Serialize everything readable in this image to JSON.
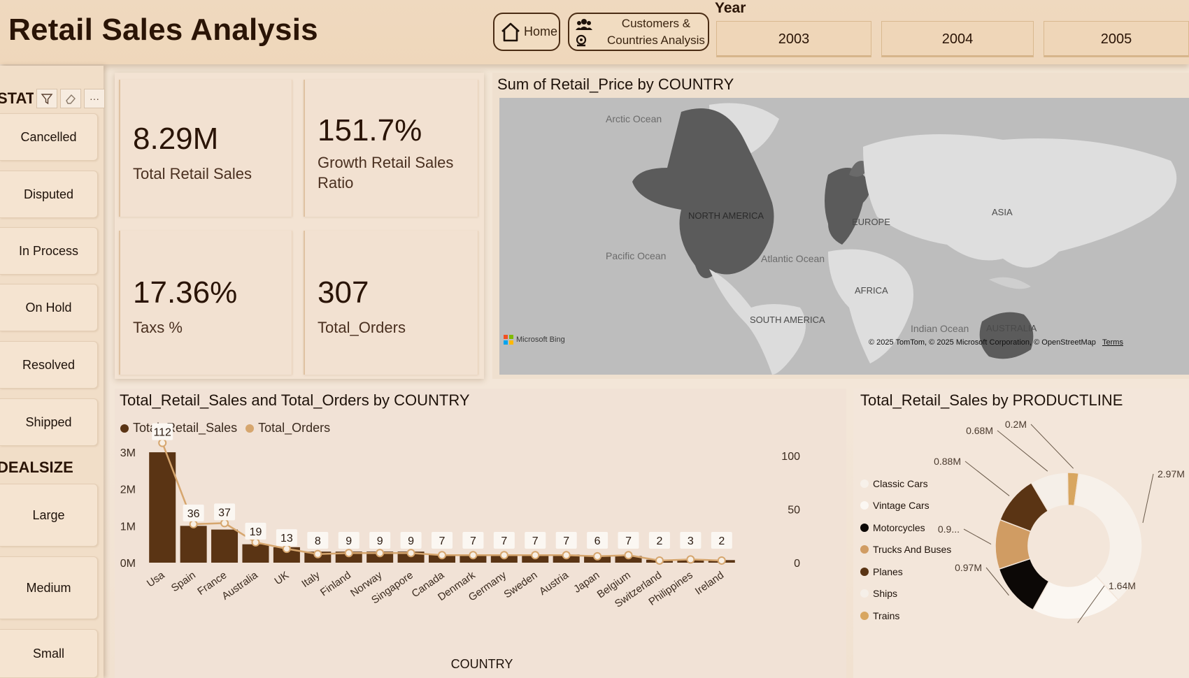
{
  "header": {
    "title": "Retail Sales Analysis",
    "nav": {
      "home_label": "Home",
      "customers_label_1": "Customers &",
      "customers_label_2": "Countries Analysis"
    },
    "year_label": "Year",
    "years": [
      "2003",
      "2004",
      "2005"
    ]
  },
  "sidebar": {
    "status_header": "STATUS",
    "status_items": [
      "Cancelled",
      "Disputed",
      "In Process",
      "On Hold",
      "Resolved",
      "Shipped"
    ],
    "dealsize_header": "DEALSIZE",
    "dealsize_items": [
      "Large",
      "Medium",
      "Small"
    ],
    "tools": {
      "more": "···"
    }
  },
  "kpis": [
    {
      "value": "8.29M",
      "label": "Total Retail Sales"
    },
    {
      "value": "151.7%",
      "label_1": "Growth Retail Sales",
      "label_2": "Ratio"
    },
    {
      "value": "17.36%",
      "label": "Taxs %"
    },
    {
      "value": "307",
      "label": "Total_Orders"
    }
  ],
  "map": {
    "title": "Sum of Retail_Price by COUNTRY",
    "labels": {
      "arctic": "Arctic Ocean",
      "north_america": "NORTH AMERICA",
      "europe": "EUROPE",
      "asia": "ASIA",
      "pacific": "Pacific Ocean",
      "atlantic": "Atlantic Ocean",
      "africa": "AFRICA",
      "south_america": "SOUTH AMERICA",
      "indian": "Indian Ocean",
      "australia": "AUSTRALIA"
    },
    "bing": "Microsoft Bing",
    "attribution": "© 2025 TomTom, © 2025 Microsoft Corporation, © OpenStreetMap",
    "terms": "Terms"
  },
  "chart_data": [
    {
      "type": "bar",
      "title": "Total_Retail_Sales and Total_Orders by COUNTRY",
      "xlabel": "COUNTRY",
      "categories": [
        "Usa",
        "Spain",
        "France",
        "Australia",
        "UK",
        "Italy",
        "Finland",
        "Norway",
        "Singapore",
        "Canada",
        "Denmark",
        "Germany",
        "Sweden",
        "Austria",
        "Japan",
        "Belgium",
        "Switzerland",
        "Philippines",
        "Ireland"
      ],
      "series": [
        {
          "name": "Total_Retail_Sales",
          "axis": "left",
          "color": "#5a3414",
          "values": [
            3.0,
            1.0,
            0.9,
            0.5,
            0.42,
            0.3,
            0.3,
            0.3,
            0.3,
            0.22,
            0.22,
            0.22,
            0.22,
            0.22,
            0.2,
            0.18,
            0.08,
            0.07,
            0.07
          ]
        },
        {
          "name": "Total_Orders",
          "axis": "right",
          "color": "#d6a66e",
          "values": [
            112,
            36,
            37,
            19,
            13,
            8,
            9,
            9,
            9,
            7,
            7,
            7,
            7,
            7,
            6,
            7,
            2,
            3,
            2
          ]
        }
      ],
      "y_left": {
        "ticks": [
          "0M",
          "1M",
          "2M",
          "3M"
        ],
        "range": [
          0,
          3.4
        ]
      },
      "y_right": {
        "ticks": [
          "0",
          "50",
          "100"
        ],
        "range": [
          0,
          117
        ]
      }
    },
    {
      "type": "pie",
      "title": "Total_Retail_Sales by PRODUCTLINE",
      "donut": true,
      "slices": [
        {
          "name": "Classic Cars",
          "value": 2.97,
          "label": "2.97M",
          "color": "#f7f1ea"
        },
        {
          "name": "Vintage Cars",
          "value": 1.64,
          "label": "1.64M",
          "color": "#fbf7f2"
        },
        {
          "name": "Motorcycles",
          "value": 0.97,
          "label": "0.97M",
          "color": "#0c0806"
        },
        {
          "name": "Trucks And Buses",
          "value": 0.9,
          "label": "0.9...",
          "color": "#d09c63"
        },
        {
          "name": "Planes",
          "value": 0.88,
          "label": "0.88M",
          "color": "#5a3414"
        },
        {
          "name": "Ships",
          "value": 0.68,
          "label": "0.68M",
          "color": "#f5efe8"
        },
        {
          "name": "Trains",
          "value": 0.2,
          "label": "0.2M",
          "color": "#d8a660"
        }
      ]
    }
  ]
}
